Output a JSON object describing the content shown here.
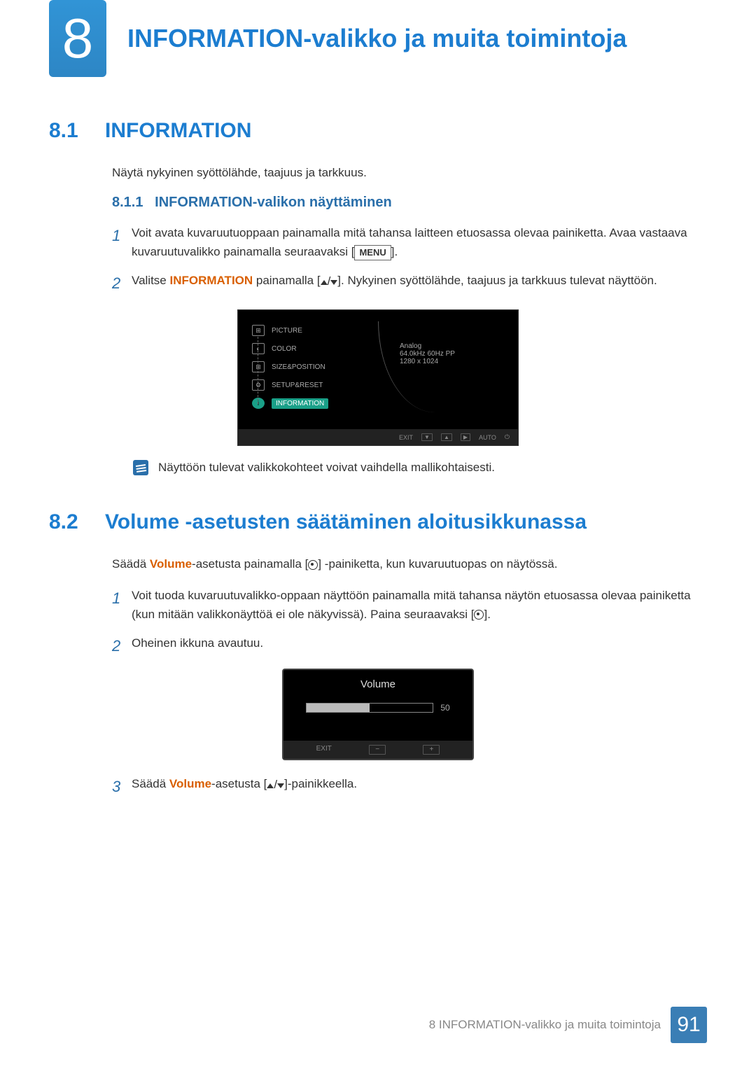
{
  "chapter": {
    "number": "8",
    "title": "INFORMATION-valikko ja muita toimintoja"
  },
  "section1": {
    "num": "8.1",
    "title": "INFORMATION",
    "intro": "Näytä nykyinen syöttölähde, taajuus ja tarkkuus.",
    "sub_num": "8.1.1",
    "sub_title": "INFORMATION-valikon näyttäminen",
    "step1_a": "Voit avata kuvaruutuoppaan painamalla mitä tahansa laitteen etuosassa olevaa painiketta. Avaa vastaava kuvaruutuvalikko painamalla seuraavaksi [",
    "step1_menu": "MENU",
    "step1_b": "].",
    "step2_a": "Valitse ",
    "step2_hl": "INFORMATION",
    "step2_b": " painamalla [",
    "step2_c": "]. Nykyinen syöttölähde, taajuus ja tarkkuus tulevat näyttöön.",
    "note": "Näyttöön tulevat valikkokohteet voivat vaihdella mallikohtaisesti."
  },
  "osd": {
    "items": [
      "PICTURE",
      "COLOR",
      "SIZE&POSITION",
      "SETUP&RESET",
      "INFORMATION"
    ],
    "info": {
      "l1": "Analog",
      "l2": "64.0kHz 60Hz PP",
      "l3": "1280 x 1024"
    },
    "footer": {
      "exit": "EXIT",
      "auto": "AUTO"
    }
  },
  "section2": {
    "num": "8.2",
    "title": "Volume -asetusten säätäminen aloitusikkunassa",
    "intro_a": "Säädä ",
    "intro_hl": "Volume",
    "intro_b": "-asetusta painamalla [",
    "intro_c": "] -painiketta, kun kuvaruutuopas on näytössä.",
    "step1_a": "Voit tuoda kuvaruutuvalikko-oppaan näyttöön painamalla mitä tahansa näytön etuosassa olevaa painiketta (kun mitään valikkonäyttöä ei ole näkyvissä). Paina seuraavaksi [",
    "step1_b": "].",
    "step2": "Oheinen ikkuna avautuu.",
    "step3_a": "Säädä ",
    "step3_hl": "Volume",
    "step3_b": "-asetusta [",
    "step3_c": "]-painikkeella."
  },
  "vol_osd": {
    "title": "Volume",
    "value": "50",
    "exit": "EXIT"
  },
  "footer": {
    "text": "8 INFORMATION-valikko ja muita toimintoja",
    "page": "91"
  }
}
